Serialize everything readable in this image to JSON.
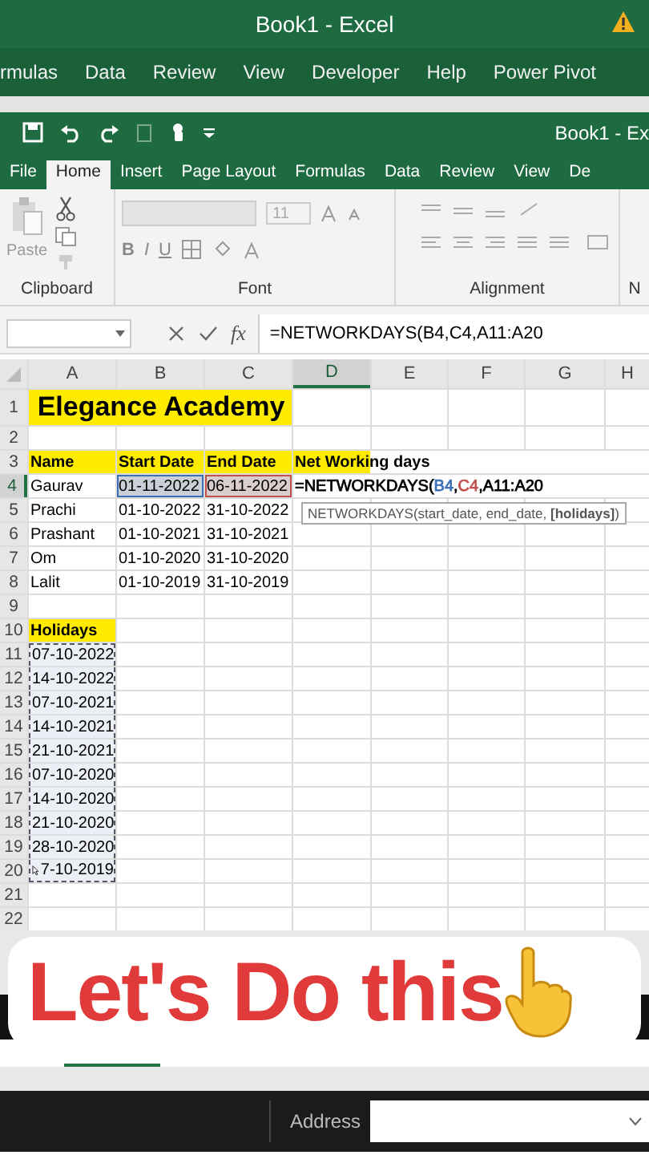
{
  "back_window": {
    "title": "Book1  -  Excel",
    "tabs": [
      "rmulas",
      "Data",
      "Review",
      "View",
      "Developer",
      "Help",
      "Power Pivot"
    ]
  },
  "window": {
    "title": "Book1  -  Ex"
  },
  "tabs": [
    {
      "label": "File",
      "selected": false
    },
    {
      "label": "Home",
      "selected": true
    },
    {
      "label": "Insert",
      "selected": false
    },
    {
      "label": "Page Layout",
      "selected": false
    },
    {
      "label": "Formulas",
      "selected": false
    },
    {
      "label": "Data",
      "selected": false
    },
    {
      "label": "Review",
      "selected": false
    },
    {
      "label": "View",
      "selected": false
    },
    {
      "label": "De",
      "selected": false
    }
  ],
  "ribbon": {
    "paste_label": "Paste",
    "font_size": "11",
    "font_buttons": [
      "B",
      "I",
      "U"
    ],
    "groups": [
      "Clipboard",
      "Font",
      "Alignment",
      "N"
    ]
  },
  "formula_bar": {
    "function_label": "fx",
    "formula": "=NETWORKDAYS(B4,C4,A11:A20"
  },
  "columns": [
    {
      "label": "A",
      "selected": false
    },
    {
      "label": "B",
      "selected": false
    },
    {
      "label": "C",
      "selected": false
    },
    {
      "label": "D",
      "selected": true
    },
    {
      "label": "E",
      "selected": false
    },
    {
      "label": "F",
      "selected": false
    },
    {
      "label": "G",
      "selected": false
    },
    {
      "label": "H",
      "selected": false
    }
  ],
  "rows": [
    {
      "number": "1",
      "selected": false,
      "cells": [
        {
          "kind": "title",
          "text": "Elegance Academy"
        }
      ]
    },
    {
      "number": "2",
      "selected": false
    },
    {
      "number": "3",
      "selected": false,
      "cells": [
        {
          "text": "Name",
          "highlighted": true,
          "bold": true
        },
        {
          "text": "Start Date",
          "highlighted": true,
          "bold": true
        },
        {
          "text": "End Date",
          "highlighted": true,
          "bold": true
        },
        {
          "text": "Net Working days",
          "highlighted": true,
          "bold": true
        }
      ]
    },
    {
      "number": "4",
      "selected": true,
      "cells": [
        {
          "text": "Gaurav"
        },
        {
          "text": "01-11-2022",
          "color": "#3b6fb6"
        },
        {
          "text": "06-11-2022",
          "color": "#c0504d"
        },
        {
          "kind": "formula",
          "parts": [
            {
              "text": "=NETWORKDAYS(",
              "color": "#000000"
            },
            {
              "text": "B4",
              "color": "#3b6fb6"
            },
            {
              "text": ",",
              "color": "#000000"
            },
            {
              "text": "C4",
              "color": "#c0504d"
            },
            {
              "text": ",A11:A20",
              "color": "#000000"
            }
          ]
        }
      ]
    },
    {
      "number": "5",
      "selected": false,
      "cells": [
        {
          "text": "Prachi"
        },
        {
          "text": "01-10-2022"
        },
        {
          "text": "31-10-2022"
        }
      ]
    },
    {
      "number": "6",
      "selected": false,
      "cells": [
        {
          "text": "Prashant"
        },
        {
          "text": "01-10-2021"
        },
        {
          "text": "31-10-2021"
        }
      ]
    },
    {
      "number": "7",
      "selected": false,
      "cells": [
        {
          "text": "Om"
        },
        {
          "text": "01-10-2020"
        },
        {
          "text": "31-10-2020"
        }
      ]
    },
    {
      "number": "8",
      "selected": false,
      "cells": [
        {
          "text": "Lalit"
        },
        {
          "text": "01-10-2019"
        },
        {
          "text": "31-10-2019"
        }
      ]
    },
    {
      "number": "9",
      "selected": false
    },
    {
      "number": "10",
      "selected": false,
      "cells": [
        {
          "text": "Holidays",
          "highlighted": true,
          "bold": true
        }
      ]
    },
    {
      "number": "11",
      "selected": false,
      "cells": [
        {
          "text": "07-10-2022",
          "in_range": true
        }
      ]
    },
    {
      "number": "12",
      "selected": false,
      "cells": [
        {
          "text": "14-10-2022",
          "in_range": true
        }
      ]
    },
    {
      "number": "13",
      "selected": false,
      "cells": [
        {
          "text": "07-10-2021",
          "in_range": true
        }
      ]
    },
    {
      "number": "14",
      "selected": false,
      "cells": [
        {
          "text": "14-10-2021",
          "in_range": true
        }
      ]
    },
    {
      "number": "15",
      "selected": false,
      "cells": [
        {
          "text": "21-10-2021",
          "in_range": true
        }
      ]
    },
    {
      "number": "16",
      "selected": false,
      "cells": [
        {
          "text": "07-10-2020",
          "in_range": true
        }
      ]
    },
    {
      "number": "17",
      "selected": false,
      "cells": [
        {
          "text": "14-10-2020",
          "in_range": true
        }
      ]
    },
    {
      "number": "18",
      "selected": false,
      "cells": [
        {
          "text": "21-10-2020",
          "in_range": true
        }
      ]
    },
    {
      "number": "19",
      "selected": false,
      "cells": [
        {
          "text": "28-10-2020",
          "in_range": true
        }
      ]
    },
    {
      "number": "20",
      "selected": false,
      "cells": [
        {
          "text": "7-10-2019",
          "in_range": true,
          "pointer": true
        }
      ]
    },
    {
      "number": "21",
      "selected": false
    },
    {
      "number": "22",
      "selected": false
    }
  ],
  "tooltip": "NETWORKDAYS(start_date, end_date, **[holidays]**)",
  "overlay": {
    "text": "Let's Do this"
  },
  "taskbar": {
    "address_label": "Address"
  }
}
